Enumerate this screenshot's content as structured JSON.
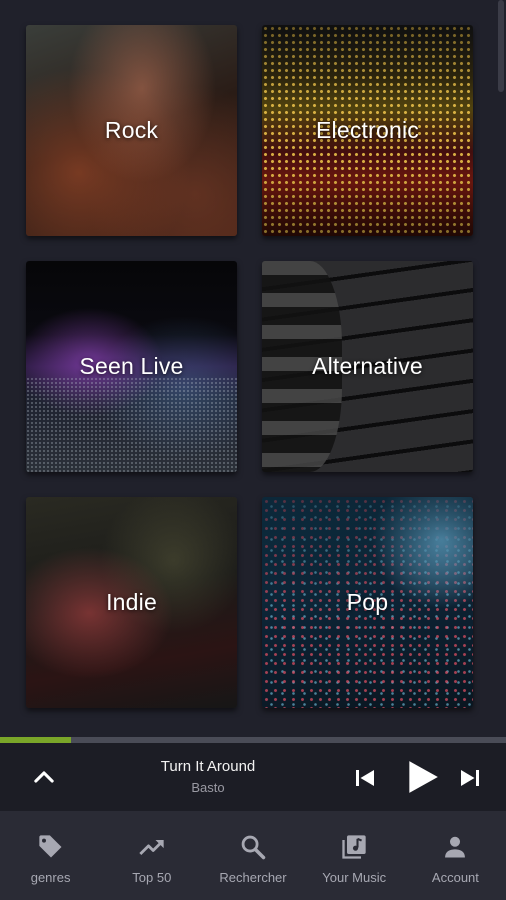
{
  "genres": [
    {
      "label": "Rock"
    },
    {
      "label": "Electronic"
    },
    {
      "label": "Seen Live"
    },
    {
      "label": "Alternative"
    },
    {
      "label": "Indie"
    },
    {
      "label": "Pop"
    }
  ],
  "player": {
    "title": "Turn It Around",
    "artist": "Basto",
    "progress": 0.14,
    "expand_icon": "chevron-up-icon",
    "prev_icon": "skip-previous-icon",
    "play_icon": "play-icon",
    "next_icon": "skip-next-icon"
  },
  "nav": [
    {
      "label": "genres",
      "icon": "tag-icon"
    },
    {
      "label": "Top 50",
      "icon": "trending-up-icon"
    },
    {
      "label": "Rechercher",
      "icon": "search-icon"
    },
    {
      "label": "Your Music",
      "icon": "music-library-icon"
    },
    {
      "label": "Account",
      "icon": "person-icon"
    }
  ],
  "colors": {
    "background": "#20212b",
    "progress_fill": "#7aa629",
    "nav_background": "#2a2b35"
  }
}
